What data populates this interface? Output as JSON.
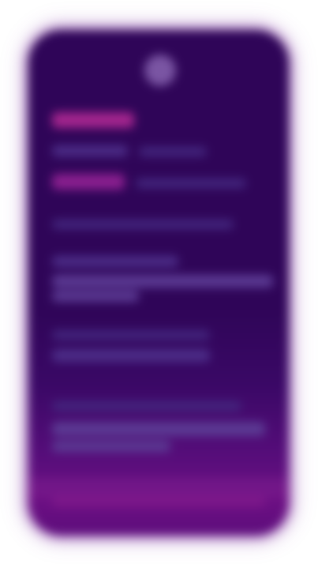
{
  "screen": {
    "description_visible_text": "",
    "colors": {
      "background_top": "#2f0558",
      "background_bottom": "#6c0f83",
      "accent": "#a4258e",
      "muted_text": "#4c2d88",
      "frame_glow": "#7d28a0"
    },
    "avatar": {
      "icon": "avatar-icon"
    },
    "rows": [
      {
        "label": "",
        "value": ""
      },
      {
        "label": "",
        "value": ""
      },
      {
        "label": "",
        "value": ""
      },
      {
        "label": "",
        "value": ""
      },
      {
        "label": "",
        "value": ""
      },
      {
        "label": "",
        "value": ""
      },
      {
        "label": "",
        "value": ""
      },
      {
        "label": "",
        "value": ""
      }
    ]
  }
}
